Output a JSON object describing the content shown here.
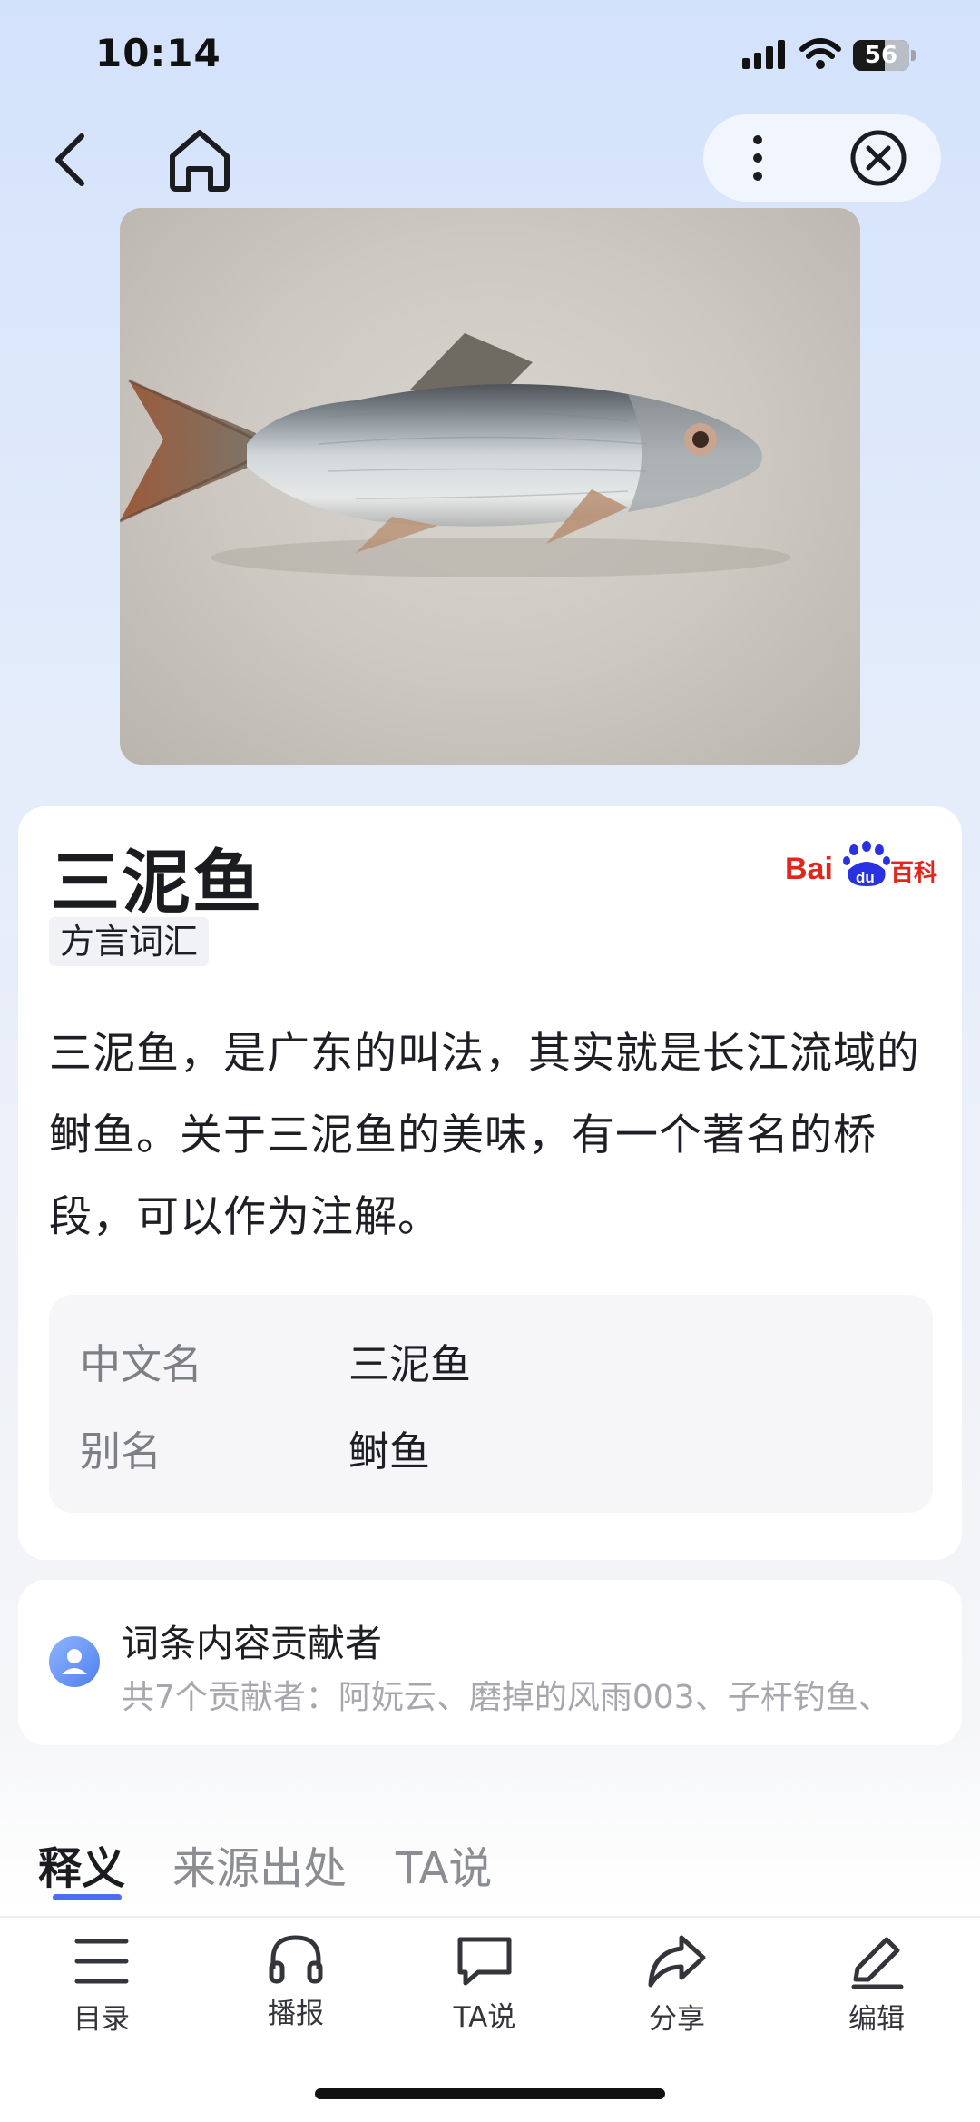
{
  "status_bar": {
    "time": "10:14",
    "battery_level": "56",
    "battery_fraction": 0.56,
    "icons": [
      "signal-icon",
      "wifi-icon",
      "battery-icon"
    ]
  },
  "nav": {
    "icons": [
      "back-arrow-icon",
      "home-icon",
      "more-vertical-icon",
      "close-circle-icon"
    ]
  },
  "entry": {
    "title": "三泥鱼",
    "source_logo": "Bai du 百科",
    "tag": "方言词汇",
    "summary": "三泥鱼，是广东的叫法，其实就是长江流域的鲥鱼。关于三泥鱼的美味，有一个著名的桥段，可以作为注解。",
    "info": [
      {
        "key": "中文名",
        "value": "三泥鱼"
      },
      {
        "key": "别名",
        "value": "鲥鱼"
      }
    ]
  },
  "contributors": {
    "title": "词条内容贡献者",
    "subtitle": "共7个贡献者：阿妧云、磨掉的风雨003、子杆钓鱼、"
  },
  "tabs": [
    {
      "label": "释义",
      "active": true
    },
    {
      "label": "来源出处",
      "active": false
    },
    {
      "label": "TA说",
      "active": false
    }
  ],
  "toolbar": [
    {
      "label": "目录",
      "icon": "list-icon"
    },
    {
      "label": "播报",
      "icon": "headphones-icon"
    },
    {
      "label": "TA说",
      "icon": "chat-bubble-icon"
    },
    {
      "label": "分享",
      "icon": "share-arrow-icon"
    },
    {
      "label": "编辑",
      "icon": "pencil-icon"
    }
  ],
  "colors": {
    "accent": "#4e6ef2",
    "baike_red": "#e1261c",
    "baike_blue": "#2932e1"
  }
}
